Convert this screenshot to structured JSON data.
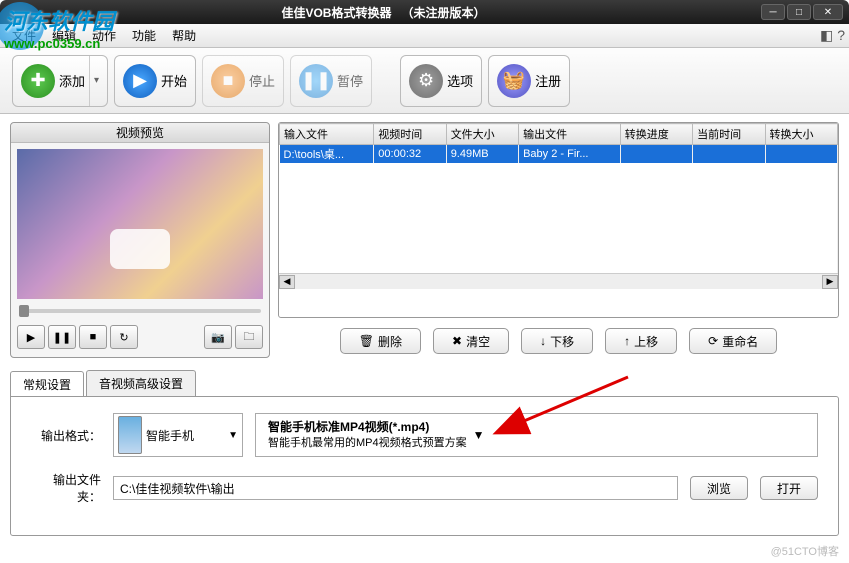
{
  "title": {
    "app": "佳佳VOB格式转换器",
    "status": "（未注册版本）"
  },
  "watermark": {
    "text": "河东软件园",
    "url": "www.pc0359.cn"
  },
  "menu": {
    "file": "文件",
    "edit": "编辑",
    "action": "动作",
    "function": "功能",
    "help": "帮助"
  },
  "toolbar": {
    "add": "添加",
    "start": "开始",
    "stop": "停止",
    "pause": "暂停",
    "options": "选项",
    "register": "注册"
  },
  "preview": {
    "title": "视频预览"
  },
  "table": {
    "headers": {
      "input": "输入文件",
      "duration": "视频时间",
      "size": "文件大小",
      "output": "输出文件",
      "progress": "转换进度",
      "current": "当前时间",
      "outsize": "转换大小"
    },
    "rows": [
      {
        "input": "D:\\tools\\桌...",
        "duration": "00:00:32",
        "size": "9.49MB",
        "output": "Baby 2 - Fir...",
        "progress": "",
        "current": "",
        "outsize": ""
      }
    ]
  },
  "actions": {
    "delete": "删除",
    "clear": "清空",
    "movedown": "下移",
    "moveup": "上移",
    "rename": "重命名"
  },
  "tabs": {
    "general": "常规设置",
    "advanced": "音视频高级设置"
  },
  "settings": {
    "format_label": "输出格式：",
    "format_category": "智能手机",
    "format_title": "智能手机标准MP4视频(*.mp4)",
    "format_desc": "智能手机最常用的MP4视频格式预置方案",
    "output_label": "输出文件夹：",
    "output_path": "C:\\佳佳视频软件\\输出",
    "browse": "浏览",
    "open": "打开"
  },
  "footer": "@51CTO博客"
}
